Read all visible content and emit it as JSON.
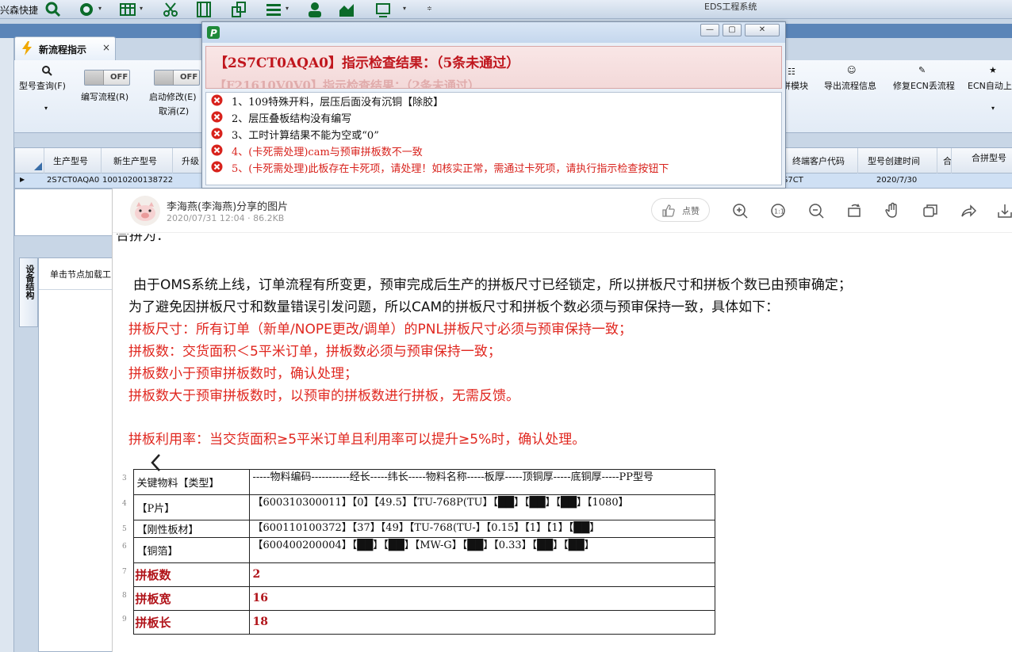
{
  "app": {
    "quick_title": "兴森快捷",
    "window_title": "EDS工程系统"
  },
  "tab": {
    "label": "新流程指示",
    "close": "×"
  },
  "ribbon": {
    "search_label": "型号查询(F)",
    "toggle1_state": "OFF",
    "toggle1_label": "编写流程(R)",
    "toggle2_state": "OFF",
    "toggle2_label1": "启动修改(E)",
    "toggle2_label2": "取消(Z)",
    "right_items": [
      "拼模块",
      "导出流程信息",
      "修复ECN丢流程",
      "ECN自动上"
    ]
  },
  "grid": {
    "columns": [
      "生产型号",
      "新生产型号",
      "升级",
      "终端客户代码",
      "型号创建时间",
      "合",
      "合拼型号"
    ],
    "row": {
      "prod_no": "2S7CT0AQA0",
      "new_prod_no": "10010200138722",
      "client_code": "S7CT",
      "created": "2020/7/30"
    }
  },
  "left_panel": {
    "side_tab": "设备结构",
    "hint": "单击节点加载工"
  },
  "dialog": {
    "title": "【2S7CT0AQA0】指示检查结果：（5条未通过）",
    "ghost_text": "【F21610V0V0】指示检查结果：（2条未通过）",
    "min": "—",
    "max": "▢",
    "close": "✕",
    "errors": [
      {
        "text": "1、109特殊开料，层压后面没有沉铜【除胶】",
        "severity": "normal"
      },
      {
        "text": "2、层压叠板结构没有编写",
        "severity": "normal"
      },
      {
        "text": "3、工时计算结果不能为空或“0”",
        "severity": "normal"
      },
      {
        "text": "4、(卡死需处理)cam与预审拼板数不一致",
        "severity": "critical"
      },
      {
        "text": "5、(卡死需处理)此板存在卡死项，请处理！如核实正常，需通过卡死项，请执行指示检查按钮下",
        "severity": "critical"
      }
    ]
  },
  "viewer": {
    "author": "李海燕(李海燕)分享的图片",
    "meta": "2020/07/31 12:04 · 86.2KB",
    "like_label": "点赞",
    "tools": [
      "zoom-in-icon",
      "actual-size-icon",
      "zoom-out-icon",
      "rotate-icon",
      "hand-icon",
      "copy-icon",
      "share-icon",
      "download-icon"
    ],
    "partial_top_text": "合拼为：",
    "paragraphs": [
      {
        "text": "由于OMS系统上线，订单流程有所变更，预审完成后生产的拼板尺寸已经锁定，所以拼板尺寸和拼板个数已由预审确定；",
        "color": "black"
      },
      {
        "text": "为了避免因拼板尺寸和数量错误引发问题，所以CAM的拼板尺寸和拼板个数必须与预审保持一致，具体如下：",
        "color": "black"
      },
      {
        "text": "拼板尺寸：所有订单（新单/NOPE更改/调单）的PNL拼板尺寸必须与预审保持一致；",
        "color": "red"
      },
      {
        "text": "拼板数：交货面积＜5平米订单，拼板数必须与预审保持一致；",
        "color": "red"
      },
      {
        "text": "拼板数小于预审拼板数时，确认处理；",
        "color": "red"
      },
      {
        "text": "拼板数大于预审拼板数时，以预审的拼板数进行拼板，无需反馈。",
        "color": "red"
      },
      {
        "text": "拼板利用率：当交货面积≥5平米订单且利用率可以提升≥5%时，确认处理。",
        "color": "red"
      }
    ],
    "table": {
      "rows": [
        {
          "rn": "3",
          "key": "关键物料【类型】",
          "value": "-----物料编码-----------经长-----纬长-----物料名称-----板厚-----顶铜厚-----底铜厚-----PP型号",
          "style": "normal"
        },
        {
          "rn": "4",
          "key": "【P片】",
          "value": "【600310300011】【0】【49.5】【TU-768P(TU】【██】【██】【██】【1080】",
          "style": "normal"
        },
        {
          "rn": "5",
          "key": "【刚性板材】",
          "value": "【600110100372】【37】【49】【TU-768(TU-】【0.15】【1】【1】【██】",
          "style": "normal"
        },
        {
          "rn": "6",
          "key": "【铜箔】",
          "value": "【600400200004】【██】【██】【MW-G】【██】【0.33】【██】【██】",
          "style": "normal"
        },
        {
          "rn": "7",
          "key": "拼板数",
          "value": "2",
          "style": "red"
        },
        {
          "rn": "8",
          "key": "拼板宽",
          "value": "16",
          "style": "red"
        },
        {
          "rn": "9",
          "key": "拼板长",
          "value": "18",
          "style": "red"
        }
      ]
    }
  },
  "colors": {
    "error_red": "#e0271f",
    "title_red": "#c0161d",
    "ribbon_blue": "#5b85b8"
  }
}
